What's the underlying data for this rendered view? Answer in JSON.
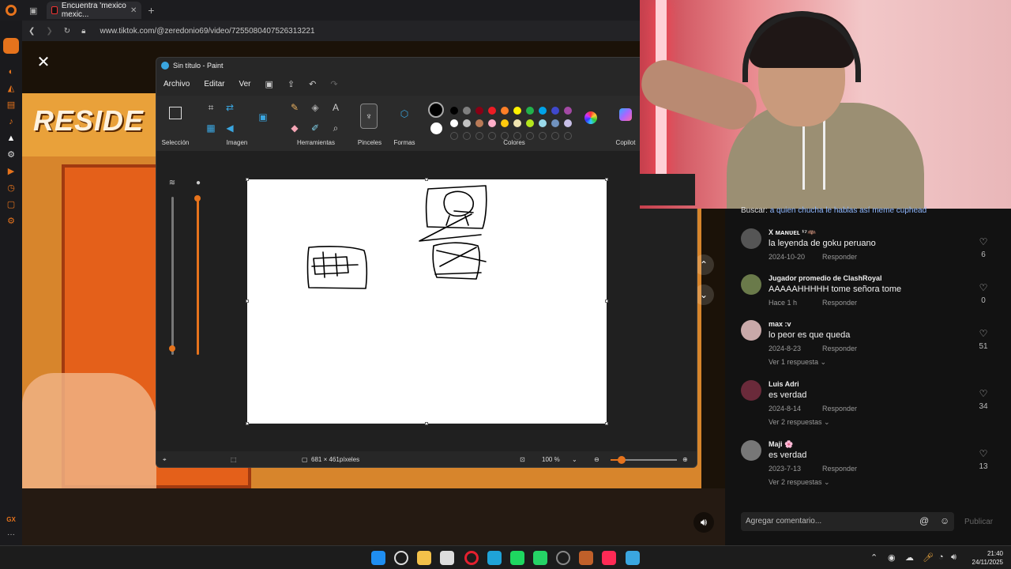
{
  "browser": {
    "tab_title": "Encuentra 'mexico mexic...",
    "url": "www.tiktok.com/@zeredonio69/video/7255080407526313221"
  },
  "video": {
    "overlay_text": "RESIDE"
  },
  "paint": {
    "window_title": "Sin título - Paint",
    "menu": [
      "Archivo",
      "Editar",
      "Ver"
    ],
    "groups": {
      "selection": "Selección",
      "image": "Imagen",
      "tools": "Herramientas",
      "brushes": "Pinceles",
      "shapes": "Formas",
      "colors": "Colores",
      "copilot": "Copilot"
    },
    "palette_row1": [
      "#000000",
      "#7f7f7f",
      "#880015",
      "#ed1c24",
      "#ff7f27",
      "#fff200",
      "#22b14c",
      "#00a2e8",
      "#3f48cc",
      "#a349a4"
    ],
    "palette_row2": [
      "#ffffff",
      "#c3c3c3",
      "#b97a57",
      "#ffaec9",
      "#ffc90e",
      "#efe4b0",
      "#b5e61d",
      "#99d9ea",
      "#7092be",
      "#c8bfe7"
    ],
    "canvas_size": "681 × 461píxeles",
    "zoom": "100 %"
  },
  "comments": {
    "search_prefix": "Buscar:",
    "search_query": "a quien chucha le hablas así meme cuphead",
    "items": [
      {
        "user": "X ᴍᴀɴᴜᴇʟ ¹⁷🦇",
        "text": "la leyenda de goku peruano",
        "date": "2024-10-20",
        "reply": "Responder",
        "likes": "6",
        "replies": "",
        "avatar_color": "#555"
      },
      {
        "user": "Jugador promedio de ClashRoyal",
        "text": "AAAAAHHHHH tome señora tome",
        "date": "Hace 1 h",
        "reply": "Responder",
        "likes": "0",
        "replies": "",
        "avatar_color": "#6a7a4a"
      },
      {
        "user": "max :v",
        "text": "lo peor es que queda",
        "date": "2024-8-23",
        "reply": "Responder",
        "likes": "51",
        "replies": "Ver 1 respuesta",
        "avatar_color": "#c9a9a9"
      },
      {
        "user": "Luis Adri",
        "text": "es verdad",
        "date": "2024-8-14",
        "reply": "Responder",
        "likes": "34",
        "replies": "Ver 2 respuestas",
        "avatar_color": "#6a2a3a"
      },
      {
        "user": "Maji 🌸",
        "text": "es verdad",
        "date": "2023-7-13",
        "reply": "Responder",
        "likes": "13",
        "replies": "Ver 2 respuestas",
        "avatar_color": "#777"
      }
    ],
    "add_placeholder": "Agregar comentario...",
    "publish": "Publicar"
  },
  "taskbar": {
    "time": "21:40",
    "date": "24/11/2025",
    "apps": [
      "windows-start",
      "search",
      "file-explorer",
      "microsoft-store",
      "opera",
      "edge",
      "spotify",
      "whatsapp",
      "settings",
      "game",
      "tiktok",
      "paint"
    ],
    "app_colors": [
      "#1f8ef1",
      "#ddd",
      "#f3c14a",
      "#dddddd",
      "#e4202f",
      "#1fa3d8",
      "#1ed760",
      "#25d366",
      "#888",
      "#c0602a",
      "#ff2a55",
      "#3aa6e0"
    ]
  },
  "sidebar": {
    "gx_label": "GX",
    "more_label": "···"
  }
}
